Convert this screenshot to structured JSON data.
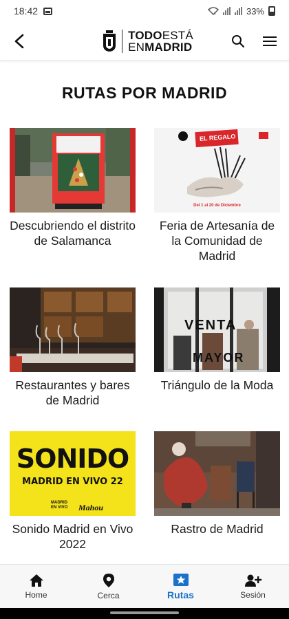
{
  "status": {
    "time": "18:42",
    "battery": "33%"
  },
  "header": {
    "logo_line1_bold": "TODO",
    "logo_line1_light": "ESTÁ",
    "logo_line2_light": "EN",
    "logo_line2_bold": "MADRID"
  },
  "page": {
    "title": "RUTAS POR MADRID"
  },
  "routes": [
    {
      "title": "Descubriendo el distrito de Salamanca"
    },
    {
      "title": "Feria de Artesanía de la Comunidad de Madrid",
      "poster_banner": "EL REGALO",
      "poster_date": "Del 1 al 20 de Diciembre"
    },
    {
      "title": "Restaurantes y bares de Madrid"
    },
    {
      "title": "Triángulo de la Moda",
      "sign_text": [
        "VENTA",
        "MAYOR"
      ]
    },
    {
      "title": "Sonido Madrid en Vivo 2022",
      "poster_big": "SONIDO",
      "poster_sub": "MADRID EN VIVO 22",
      "poster_logo_a": "MADRID EN VIVO",
      "poster_logo_b": "Mahou"
    },
    {
      "title": "Rastro de Madrid"
    }
  ],
  "nav": {
    "items": [
      {
        "label": "Home",
        "icon": "home-icon"
      },
      {
        "label": "Cerca",
        "icon": "location-pin-icon"
      },
      {
        "label": "Rutas",
        "icon": "routes-icon",
        "active": true
      },
      {
        "label": "Sesión",
        "icon": "add-user-icon"
      }
    ],
    "accent": "#1a73c8"
  },
  "colors": {
    "poster_yellow": "#f4e21b",
    "poster_red": "#d9262b"
  }
}
